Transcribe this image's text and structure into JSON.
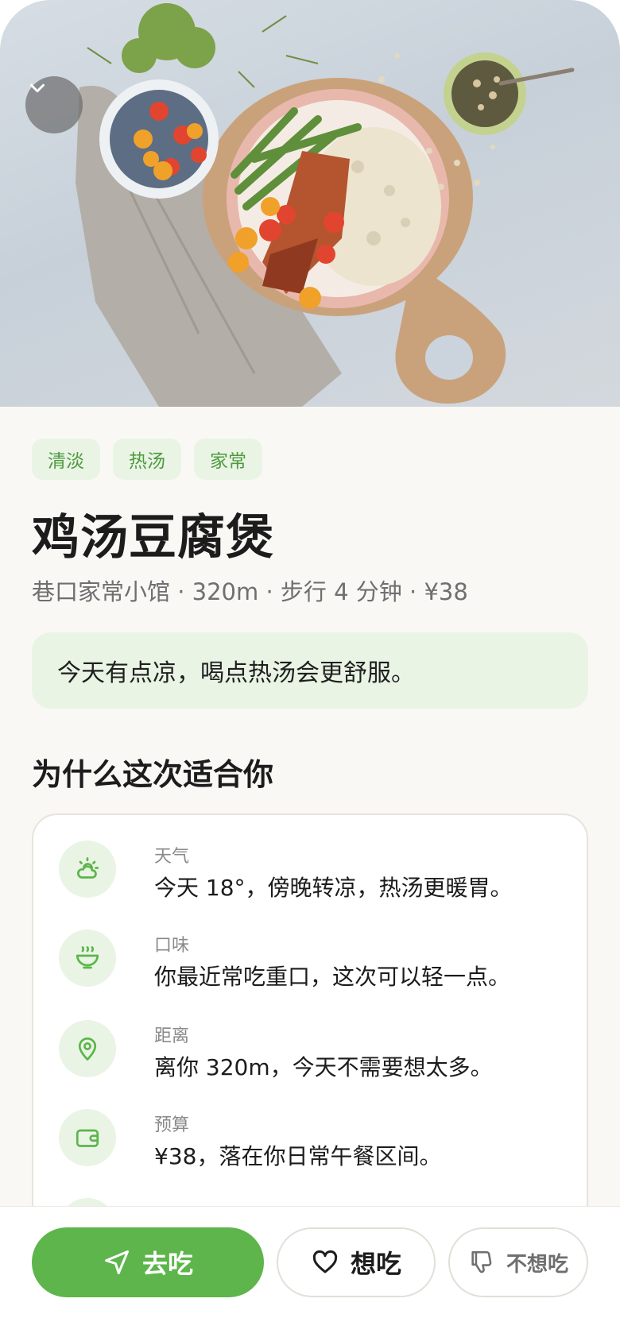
{
  "dish": {
    "tags": [
      "清淡",
      "热汤",
      "家常"
    ],
    "name": "鸡汤豆腐煲",
    "meta": "巷口家常小馆 · 320m · 步行 4 分钟 · ¥38",
    "note": "今天有点凉，喝点热汤会更舒服。"
  },
  "reasons": {
    "title": "为什么这次适合你",
    "items": [
      {
        "icon": "weather-icon",
        "label": "天气",
        "text": "今天 18°，傍晚转凉，热汤更暖胃。"
      },
      {
        "icon": "soup-bowl-icon",
        "label": "口味",
        "text": "你最近常吃重口，这次可以轻一点。"
      },
      {
        "icon": "location-pin-icon",
        "label": "距离",
        "text": "离你 320m，今天不需要想太多。"
      },
      {
        "icon": "wallet-icon",
        "label": "预算",
        "text": "¥38，落在你日常午餐区间。"
      }
    ]
  },
  "actions": {
    "go_label": "去吃",
    "want_label": "想吃",
    "not_want_label": "不想吃"
  },
  "colors": {
    "accent": "#5db54b",
    "accent_soft": "#e9f4e5",
    "text": "#1c1c1c",
    "muted": "#6f6f6f"
  }
}
